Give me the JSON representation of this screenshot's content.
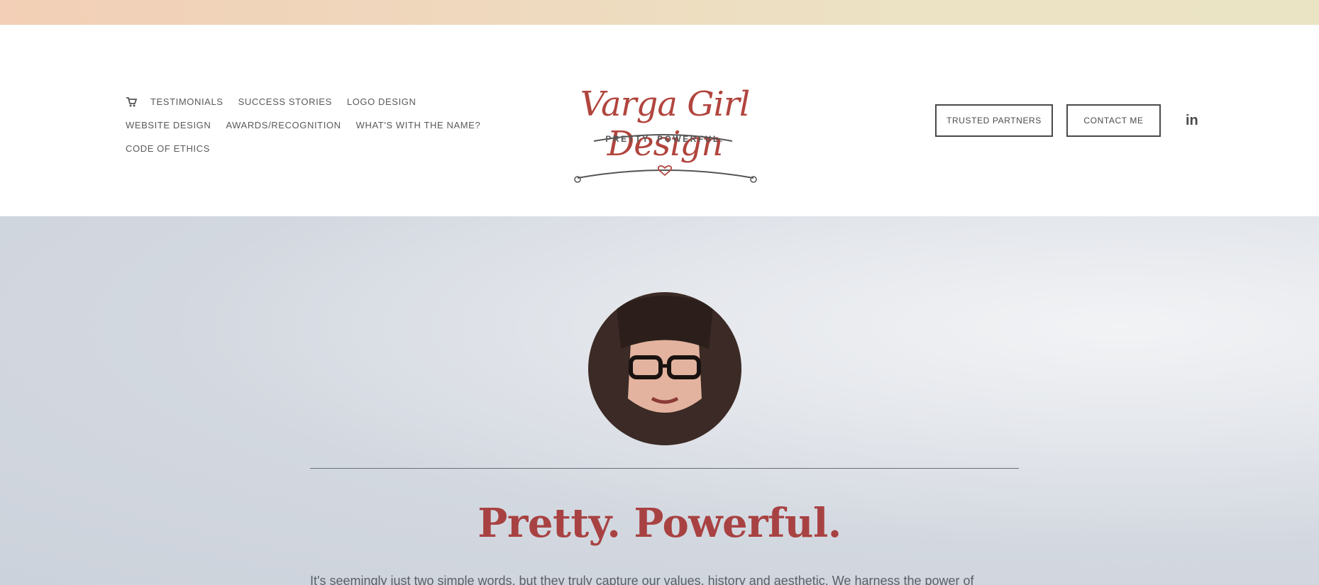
{
  "nav": {
    "row1": [
      "TESTIMONIALS",
      "SUCCESS STORIES",
      "LOGO DESIGN"
    ],
    "row2": [
      "WEBSITE DESIGN",
      "AWARDS/RECOGNITION",
      "WHAT'S WITH THE NAME?"
    ],
    "row3": [
      "CODE OF ETHICS"
    ],
    "cart_icon": "cart-icon"
  },
  "logo": {
    "script": "Varga Girl Design",
    "tagline": "PRETTY. POWERFUL."
  },
  "buttons": {
    "partners": "TRUSTED PARTNERS",
    "contact": "CONTACT ME"
  },
  "social": {
    "linkedin": "in"
  },
  "hero": {
    "title": "Pretty. Powerful.",
    "text": "It's seemingly just two simple words, but they truly capture our values, history and aesthetic. We harness the power of"
  },
  "colors": {
    "accent": "#a84242",
    "text": "#5a5a5a"
  }
}
